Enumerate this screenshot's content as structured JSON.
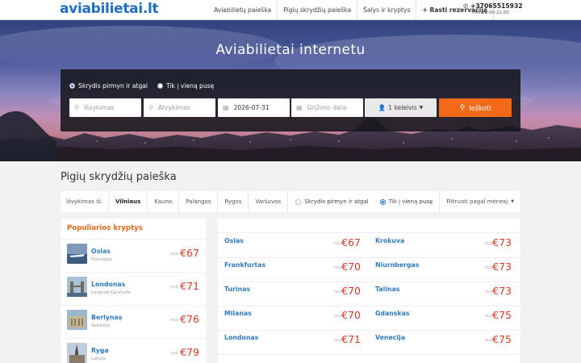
{
  "header": {
    "logo": "aviabilietai.lt",
    "nav": [
      "Aviabilietų paieška",
      "Pigių skrydžių paieška",
      "Šalys ir kryptys"
    ],
    "reservation": "Rasti rezervaciją",
    "phone": "+37065515932",
    "hours": "I-VII 10:00-21:00"
  },
  "hero": {
    "title": "Aviabilietai internetu",
    "trip_roundtrip": "Skrydis pirmyn ir atgal",
    "trip_oneway": "Tik į vieną pusę",
    "from_placeholder": "Išvykimas",
    "to_placeholder": "Atvykimas",
    "depart_date": "2026-07-31",
    "return_placeholder": "Grįžimo data",
    "passengers": "1 keleivis",
    "search_label": "Ieškoti"
  },
  "section": {
    "title": "Pigių skrydžių paieška",
    "departure_label": "Išvykimas iš:",
    "cities": [
      "Vilniaus",
      "Kauno",
      "Palangos",
      "Rygos",
      "Varšuvos"
    ],
    "opt_roundtrip": "Skrydis pirmyn ir atgal",
    "opt_oneway": "Tik į vieną pusę",
    "month_filter": "Filtruoti pagal mėnesį"
  },
  "popular": {
    "title": "Populiarios kryptys",
    "nuo": "nuo",
    "items": [
      {
        "city": "Oslas",
        "country": "Norvegija",
        "price": "€67"
      },
      {
        "city": "Londonas",
        "country": "Jungtinė Karalystė",
        "price": "€71"
      },
      {
        "city": "Berlynas",
        "country": "Vokietija",
        "price": "€76"
      },
      {
        "city": "Ryga",
        "country": "Latvija",
        "price": "€79"
      }
    ]
  },
  "grid": {
    "nuo": "nuo",
    "left": [
      {
        "city": "Oslas",
        "price": "€67"
      },
      {
        "city": "Frankfurtas",
        "price": "€70"
      },
      {
        "city": "Turinas",
        "price": "€70"
      },
      {
        "city": "Milanas",
        "price": "€70"
      },
      {
        "city": "Londonas",
        "price": "€71"
      }
    ],
    "right": [
      {
        "city": "Krokuva",
        "price": "€73"
      },
      {
        "city": "Niurnbergas",
        "price": "€73"
      },
      {
        "city": "Talinas",
        "price": "€73"
      },
      {
        "city": "Gdanskas",
        "price": "€75"
      },
      {
        "city": "Venecija",
        "price": "€75"
      }
    ]
  },
  "colors": {
    "accent": "#f26a18",
    "link": "#2f7bbd",
    "price": "#d93a25",
    "popular_title": "#e4691e"
  }
}
